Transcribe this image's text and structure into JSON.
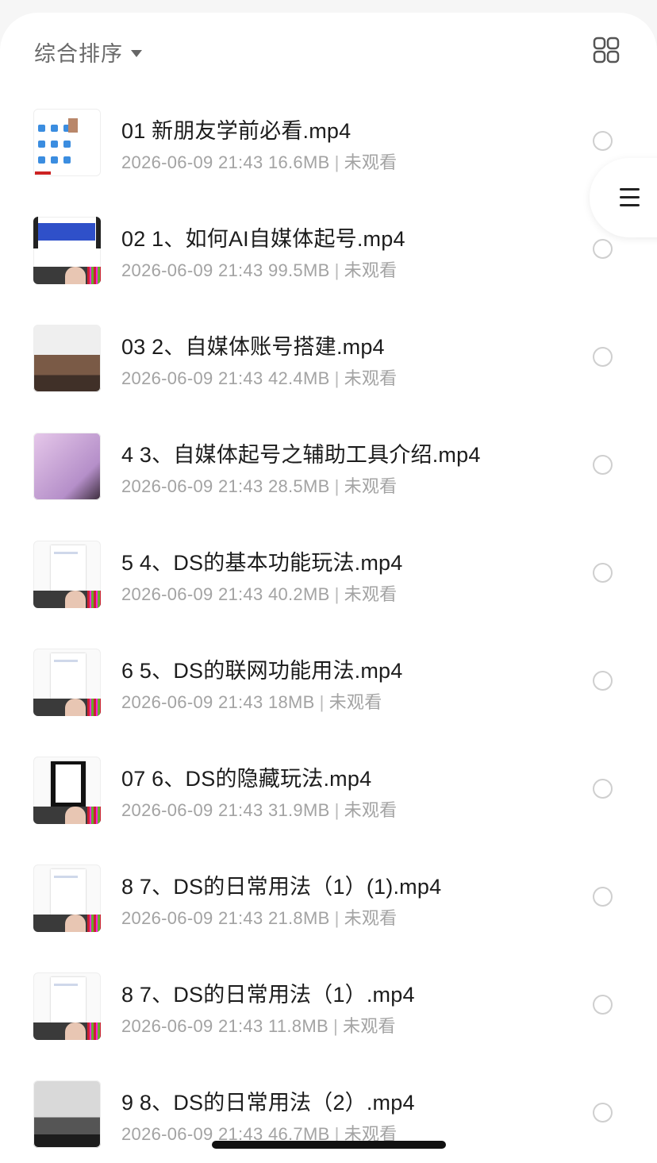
{
  "toolbar": {
    "sort_label": "综合排序",
    "sort_caret_icon": "caret-down-icon",
    "view_toggle_icon": "grid-view-icon"
  },
  "floating_menu_icon": "hamburger-menu-icon",
  "files": [
    {
      "title": "01 新朋友学前必看.mp4",
      "date": "2026-06-09 21:43",
      "size": "16.6MB",
      "status": "未观看"
    },
    {
      "title": "02 1、如何AI自媒体起号.mp4",
      "date": "2026-06-09 21:43",
      "size": "99.5MB",
      "status": "未观看"
    },
    {
      "title": "03 2、自媒体账号搭建.mp4",
      "date": "2026-06-09 21:43",
      "size": "42.4MB",
      "status": "未观看"
    },
    {
      "title": "4 3、自媒体起号之辅助工具介绍.mp4",
      "date": "2026-06-09 21:43",
      "size": "28.5MB",
      "status": "未观看"
    },
    {
      "title": "5 4、DS的基本功能玩法.mp4",
      "date": "2026-06-09 21:43",
      "size": "40.2MB",
      "status": "未观看"
    },
    {
      "title": "6 5、DS的联网功能用法.mp4",
      "date": "2026-06-09 21:43",
      "size": "18MB",
      "status": "未观看"
    },
    {
      "title": "07 6、DS的隐藏玩法.mp4",
      "date": "2026-06-09 21:43",
      "size": "31.9MB",
      "status": "未观看"
    },
    {
      "title": "8 7、DS的日常用法（1）(1).mp4",
      "date": "2026-06-09 21:43",
      "size": "21.8MB",
      "status": "未观看"
    },
    {
      "title": "8 7、DS的日常用法（1）.mp4",
      "date": "2026-06-09 21:43",
      "size": "11.8MB",
      "status": "未观看"
    },
    {
      "title": "9 8、DS的日常用法（2）.mp4",
      "date": "2026-06-09 21:43",
      "size": "46.7MB",
      "status": "未观看"
    }
  ]
}
